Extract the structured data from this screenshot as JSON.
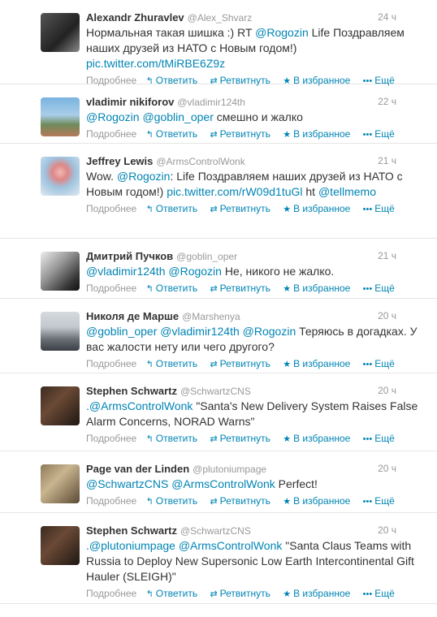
{
  "tweets": [
    {
      "name": "Alexandr Zhuravlev",
      "handle": "@Alex_Shvarz",
      "time": "24 ч",
      "segments": [
        {
          "t": "Нормальная такая шишка :) RT "
        },
        {
          "t": "@Rogozin",
          "link": true
        },
        {
          "t": " Life Поздравляем наших друзей из НАТО с Новым годом!) "
        },
        {
          "t": "pic.twitter.com/tMiRBE6Z9z",
          "link": true
        }
      ]
    },
    {
      "name": "vladimir nikiforov",
      "handle": "@vladimir124th",
      "time": "22 ч",
      "segments": [
        {
          "t": "@Rogozin",
          "link": true
        },
        {
          "t": " "
        },
        {
          "t": "@goblin_oper",
          "link": true
        },
        {
          "t": " смешно и жалко"
        }
      ]
    },
    {
      "name": "Jeffrey Lewis",
      "handle": "@ArmsControlWonk",
      "time": "21 ч",
      "segments": [
        {
          "t": "Wow. "
        },
        {
          "t": "@Rogozin",
          "link": true
        },
        {
          "t": ": Life Поздравляем наших друзей из НАТО с Новым годом!) "
        },
        {
          "t": "pic.twitter.com/rW09d1tuGl",
          "link": true
        },
        {
          "t": " ht "
        },
        {
          "t": "@tellmemo",
          "link": true
        }
      ]
    },
    {
      "name": "Дмитрий Пучков",
      "handle": "@goblin_oper",
      "time": "21 ч",
      "segments": [
        {
          "t": "@vladimir124th",
          "link": true
        },
        {
          "t": " "
        },
        {
          "t": "@Rogozin",
          "link": true
        },
        {
          "t": " Не, никого не жалко."
        }
      ]
    },
    {
      "name": "Николя де Марше",
      "handle": "@Marshenya",
      "time": "20 ч",
      "segments": [
        {
          "t": "@goblin_oper",
          "link": true
        },
        {
          "t": " "
        },
        {
          "t": "@vladimir124th",
          "link": true
        },
        {
          "t": " "
        },
        {
          "t": "@Rogozin",
          "link": true
        },
        {
          "t": " Теряюсь в догадках. У вас жалости нету или чего другого?"
        }
      ]
    },
    {
      "name": "Stephen Schwartz",
      "handle": "@SchwartzCNS",
      "time": "20 ч",
      "segments": [
        {
          "t": ".@ArmsControlWonk",
          "link": true
        },
        {
          "t": " \"Santa's New Delivery System Raises False Alarm Concerns, NORAD Warns\""
        }
      ]
    },
    {
      "name": "Page van der Linden",
      "handle": "@plutoniumpage",
      "time": "20 ч",
      "segments": [
        {
          "t": "@SchwartzCNS",
          "link": true
        },
        {
          "t": " "
        },
        {
          "t": "@ArmsControlWonk",
          "link": true
        },
        {
          "t": " Perfect!"
        }
      ]
    },
    {
      "name": "Stephen Schwartz",
      "handle": "@SchwartzCNS",
      "time": "20 ч",
      "segments": [
        {
          "t": ".@plutoniumpage",
          "link": true
        },
        {
          "t": " "
        },
        {
          "t": "@ArmsControlWonk",
          "link": true
        },
        {
          "t": " \"Santa Claus Teams with Russia to Deploy New Supersonic Low Earth Intercontinental Gift Hauler (SLEIGH)\""
        }
      ]
    }
  ],
  "actions": {
    "details": "Подробнее",
    "reply": "Ответить",
    "retweet": "Ретвитнуть",
    "favorite": "В избранное",
    "more": "Ещё"
  },
  "icons": {
    "reply": "reply-arrow-icon",
    "retweet": "retweet-arrows-icon",
    "favorite": "star-icon",
    "more": "dots-icon"
  },
  "colors": {
    "link": "#0084b4",
    "muted": "#999999",
    "text": "#333333"
  }
}
